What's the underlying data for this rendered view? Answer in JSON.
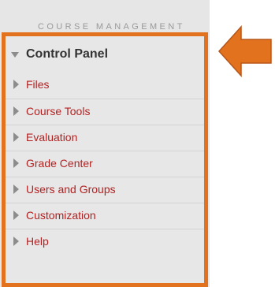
{
  "section": {
    "header": "COURSE MANAGEMENT"
  },
  "control_panel": {
    "title": "Control Panel",
    "expanded": true,
    "items": [
      {
        "label": "Files"
      },
      {
        "label": "Course Tools"
      },
      {
        "label": "Evaluation"
      },
      {
        "label": "Grade Center"
      },
      {
        "label": "Users and Groups"
      },
      {
        "label": "Customization"
      },
      {
        "label": "Help"
      }
    ]
  },
  "colors": {
    "highlight_border": "#e2721e",
    "arrow_fill": "#e2721e",
    "link_text": "#b22222",
    "sidebar_bg": "#e6e6e6"
  },
  "icons": {
    "expanded": "triangle-down-icon",
    "collapsed": "triangle-right-icon",
    "callout": "left-arrow-icon"
  }
}
